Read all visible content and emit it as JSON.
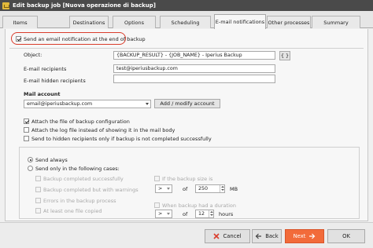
{
  "window": {
    "title": "Edit backup job  [Nuova operazione di backup]",
    "icon": "backup-job-icon"
  },
  "tabs": [
    {
      "label": "Items"
    },
    {
      "label": "Destinations"
    },
    {
      "label": "Options"
    },
    {
      "label": "Scheduling"
    },
    {
      "label": "E-mail notifications",
      "active": true
    },
    {
      "label": "Other processes"
    },
    {
      "label": "Summary"
    }
  ],
  "email": {
    "send_notification_label": "Send an email notification at the end of backup",
    "send_notification_checked": true,
    "object_label": "Object:",
    "object_value": "{BACKUP_RESULT} - {JOB_NAME} - Iperius Backup",
    "object_button": "{ }",
    "recipients_label": "E-mail recipients",
    "recipients_value": "test@iperiusbackup.com",
    "hidden_recipients_label": "E-mail hidden recipients",
    "hidden_recipients_value": ""
  },
  "mail_account": {
    "heading": "Mail account",
    "selected": "email@iperiusbackup.com",
    "add_button": "Add / modify account"
  },
  "attachments": [
    {
      "label": "Attach the file of backup configuration",
      "checked": true
    },
    {
      "label": "Attach the log file instead of showing it in the mail body",
      "checked": false
    },
    {
      "label": "Send to hidden recipients only if backup is not completed successfully",
      "checked": false
    }
  ],
  "send_options": {
    "always_label": "Send always",
    "always_selected": true,
    "only_cases_label": "Send only in the following cases:",
    "cases": [
      {
        "label": "Backup completed successfully"
      },
      {
        "label": "Backup completed but with warnings"
      },
      {
        "label": "Errors in the backup process"
      },
      {
        "label": "At least one file copied"
      }
    ],
    "size_condition": {
      "label": "If the backup size is",
      "operator": ">",
      "of_label": "of",
      "value": "250",
      "unit": "MB"
    },
    "duration_condition": {
      "label": "When backup had a duration",
      "operator": ">",
      "of_label": "of",
      "value": "12",
      "unit": "hours"
    }
  },
  "footer": {
    "cancel": "Cancel",
    "back": "Back",
    "next": "Next",
    "ok": "OK",
    "accent": "#f26b3a",
    "highlight_ring": "#d93c2b"
  }
}
